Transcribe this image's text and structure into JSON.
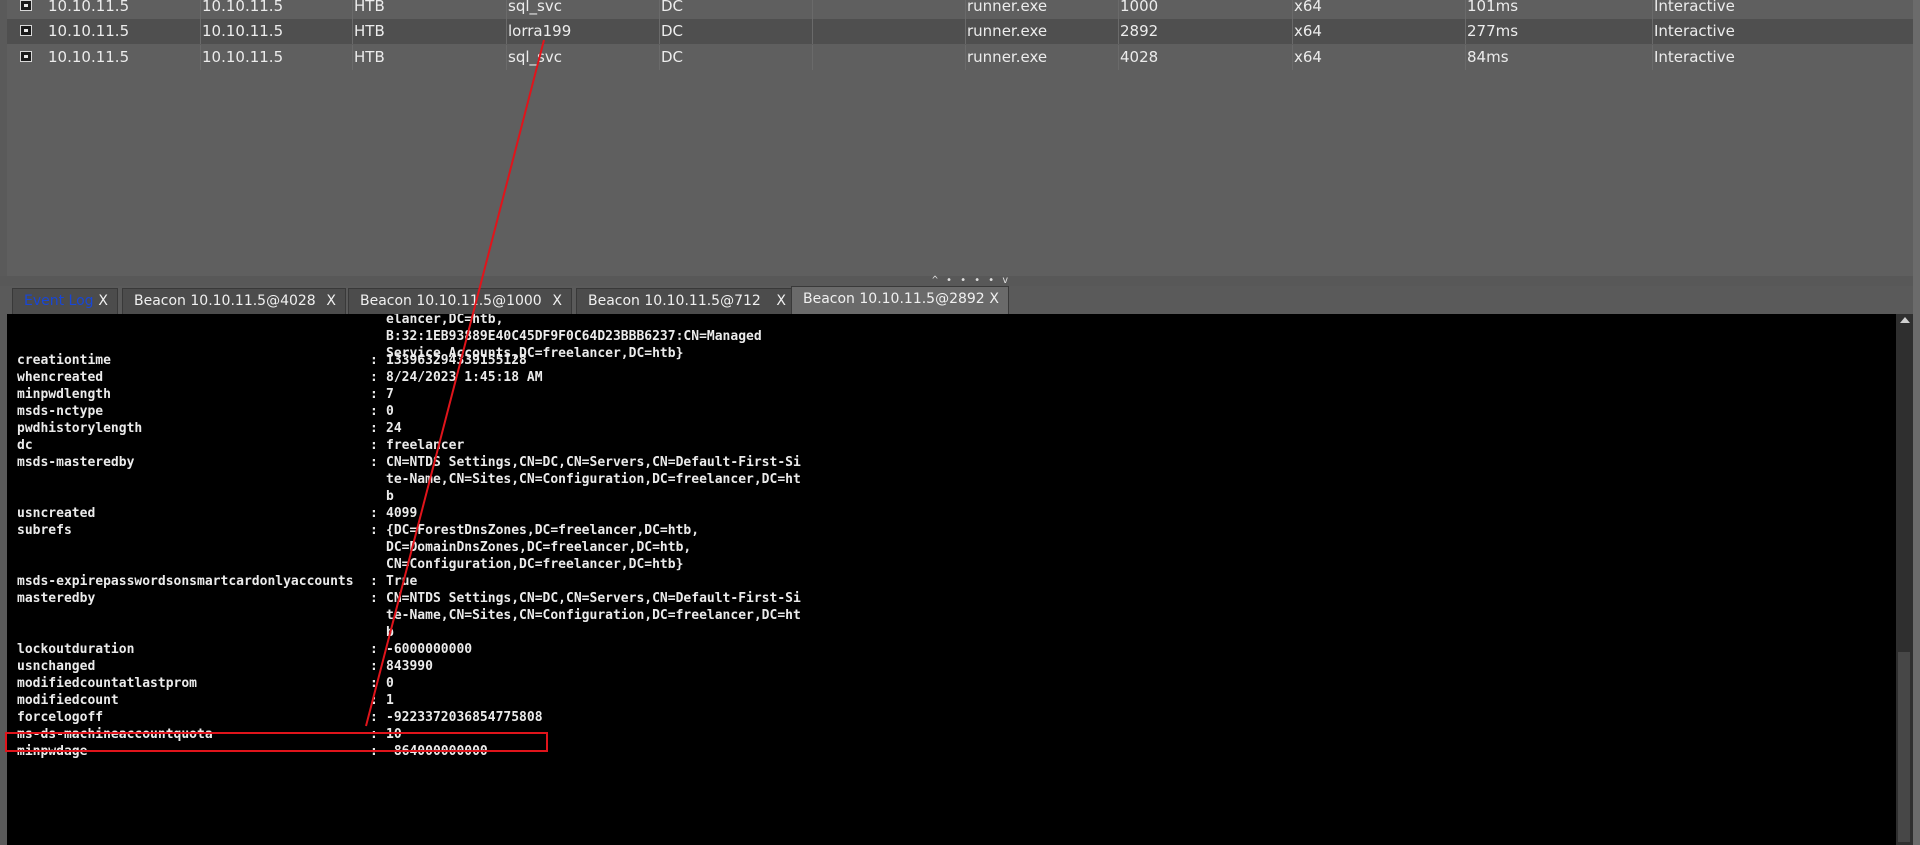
{
  "sessions": [
    {
      "external": "10.10.11.5",
      "internal": "10.10.11.5",
      "listener": "HTB",
      "user": "sql_svc",
      "computer": "DC",
      "note": "",
      "process": "runner.exe",
      "pid": "1000",
      "arch": "x64",
      "last": "101ms",
      "type": "Interactive"
    },
    {
      "external": "10.10.11.5",
      "internal": "10.10.11.5",
      "listener": "HTB",
      "user": "lorra199",
      "computer": "DC",
      "note": "",
      "process": "runner.exe",
      "pid": "2892",
      "arch": "x64",
      "last": "277ms",
      "type": "Interactive"
    },
    {
      "external": "10.10.11.5",
      "internal": "10.10.11.5",
      "listener": "HTB",
      "user": "sql_svc",
      "computer": "DC",
      "note": "",
      "process": "runner.exe",
      "pid": "4028",
      "arch": "x64",
      "last": "84ms",
      "type": "Interactive"
    }
  ],
  "divider": {
    "grip": "^ • • • • v"
  },
  "tabs": [
    {
      "label": "Event Log",
      "close": "X"
    },
    {
      "label": "Beacon 10.10.11.5@4028",
      "close": "X"
    },
    {
      "label": "Beacon 10.10.11.5@1000",
      "close": "X"
    },
    {
      "label": "Beacon 10.10.11.5@712",
      "close": "X"
    },
    {
      "label": "Beacon 10.10.11.5@2892",
      "close": "X"
    }
  ],
  "console": {
    "continuation_top": [
      "elancer,DC=htb,",
      "B:32:1EB93889E40C45DF9F0C64D23BBB6237:CN=Managed",
      "Service Accounts,DC=freelancer,DC=htb}"
    ],
    "entries": [
      {
        "key": "creationtime",
        "val": [
          "133963294339155128"
        ]
      },
      {
        "key": "whencreated",
        "val": [
          "8/24/2023 1:45:18 AM"
        ]
      },
      {
        "key": "minpwdlength",
        "val": [
          "7"
        ]
      },
      {
        "key": "msds-nctype",
        "val": [
          "0"
        ]
      },
      {
        "key": "pwdhistorylength",
        "val": [
          "24"
        ]
      },
      {
        "key": "dc",
        "val": [
          "freelancer"
        ]
      },
      {
        "key": "msds-masteredby",
        "val": [
          "CN=NTDS Settings,CN=DC,CN=Servers,CN=Default-First-Si",
          "te-Name,CN=Sites,CN=Configuration,DC=freelancer,DC=ht",
          "b"
        ]
      },
      {
        "key": "usncreated",
        "val": [
          "4099"
        ]
      },
      {
        "key": "subrefs",
        "val": [
          "{DC=ForestDnsZones,DC=freelancer,DC=htb,",
          "DC=DomainDnsZones,DC=freelancer,DC=htb,",
          "CN=Configuration,DC=freelancer,DC=htb}"
        ]
      },
      {
        "key": "msds-expirepasswordsonsmartcardonlyaccounts",
        "val": [
          "True"
        ]
      },
      {
        "key": "masteredby",
        "val": [
          "CN=NTDS Settings,CN=DC,CN=Servers,CN=Default-First-Si",
          "te-Name,CN=Sites,CN=Configuration,DC=freelancer,DC=ht",
          "b"
        ]
      },
      {
        "key": "lockoutduration",
        "val": [
          "-6000000000"
        ]
      },
      {
        "key": "usnchanged",
        "val": [
          "843990"
        ]
      },
      {
        "key": "modifiedcountatlastprom",
        "val": [
          "0"
        ]
      },
      {
        "key": "modifiedcount",
        "val": [
          "1"
        ]
      },
      {
        "key": "forcelogoff",
        "val": [
          "-9223372036854775808"
        ]
      },
      {
        "key": "ms-ds-machineaccountquota",
        "val": [
          "10"
        ],
        "highlighted": true
      },
      {
        "key": "minpwdage",
        "val": [
          "-864000000000"
        ]
      }
    ],
    "colon": ":"
  },
  "colors": {
    "highlight": "#e0141b",
    "console_bg": "#000000",
    "event_log": "#1846d6"
  }
}
